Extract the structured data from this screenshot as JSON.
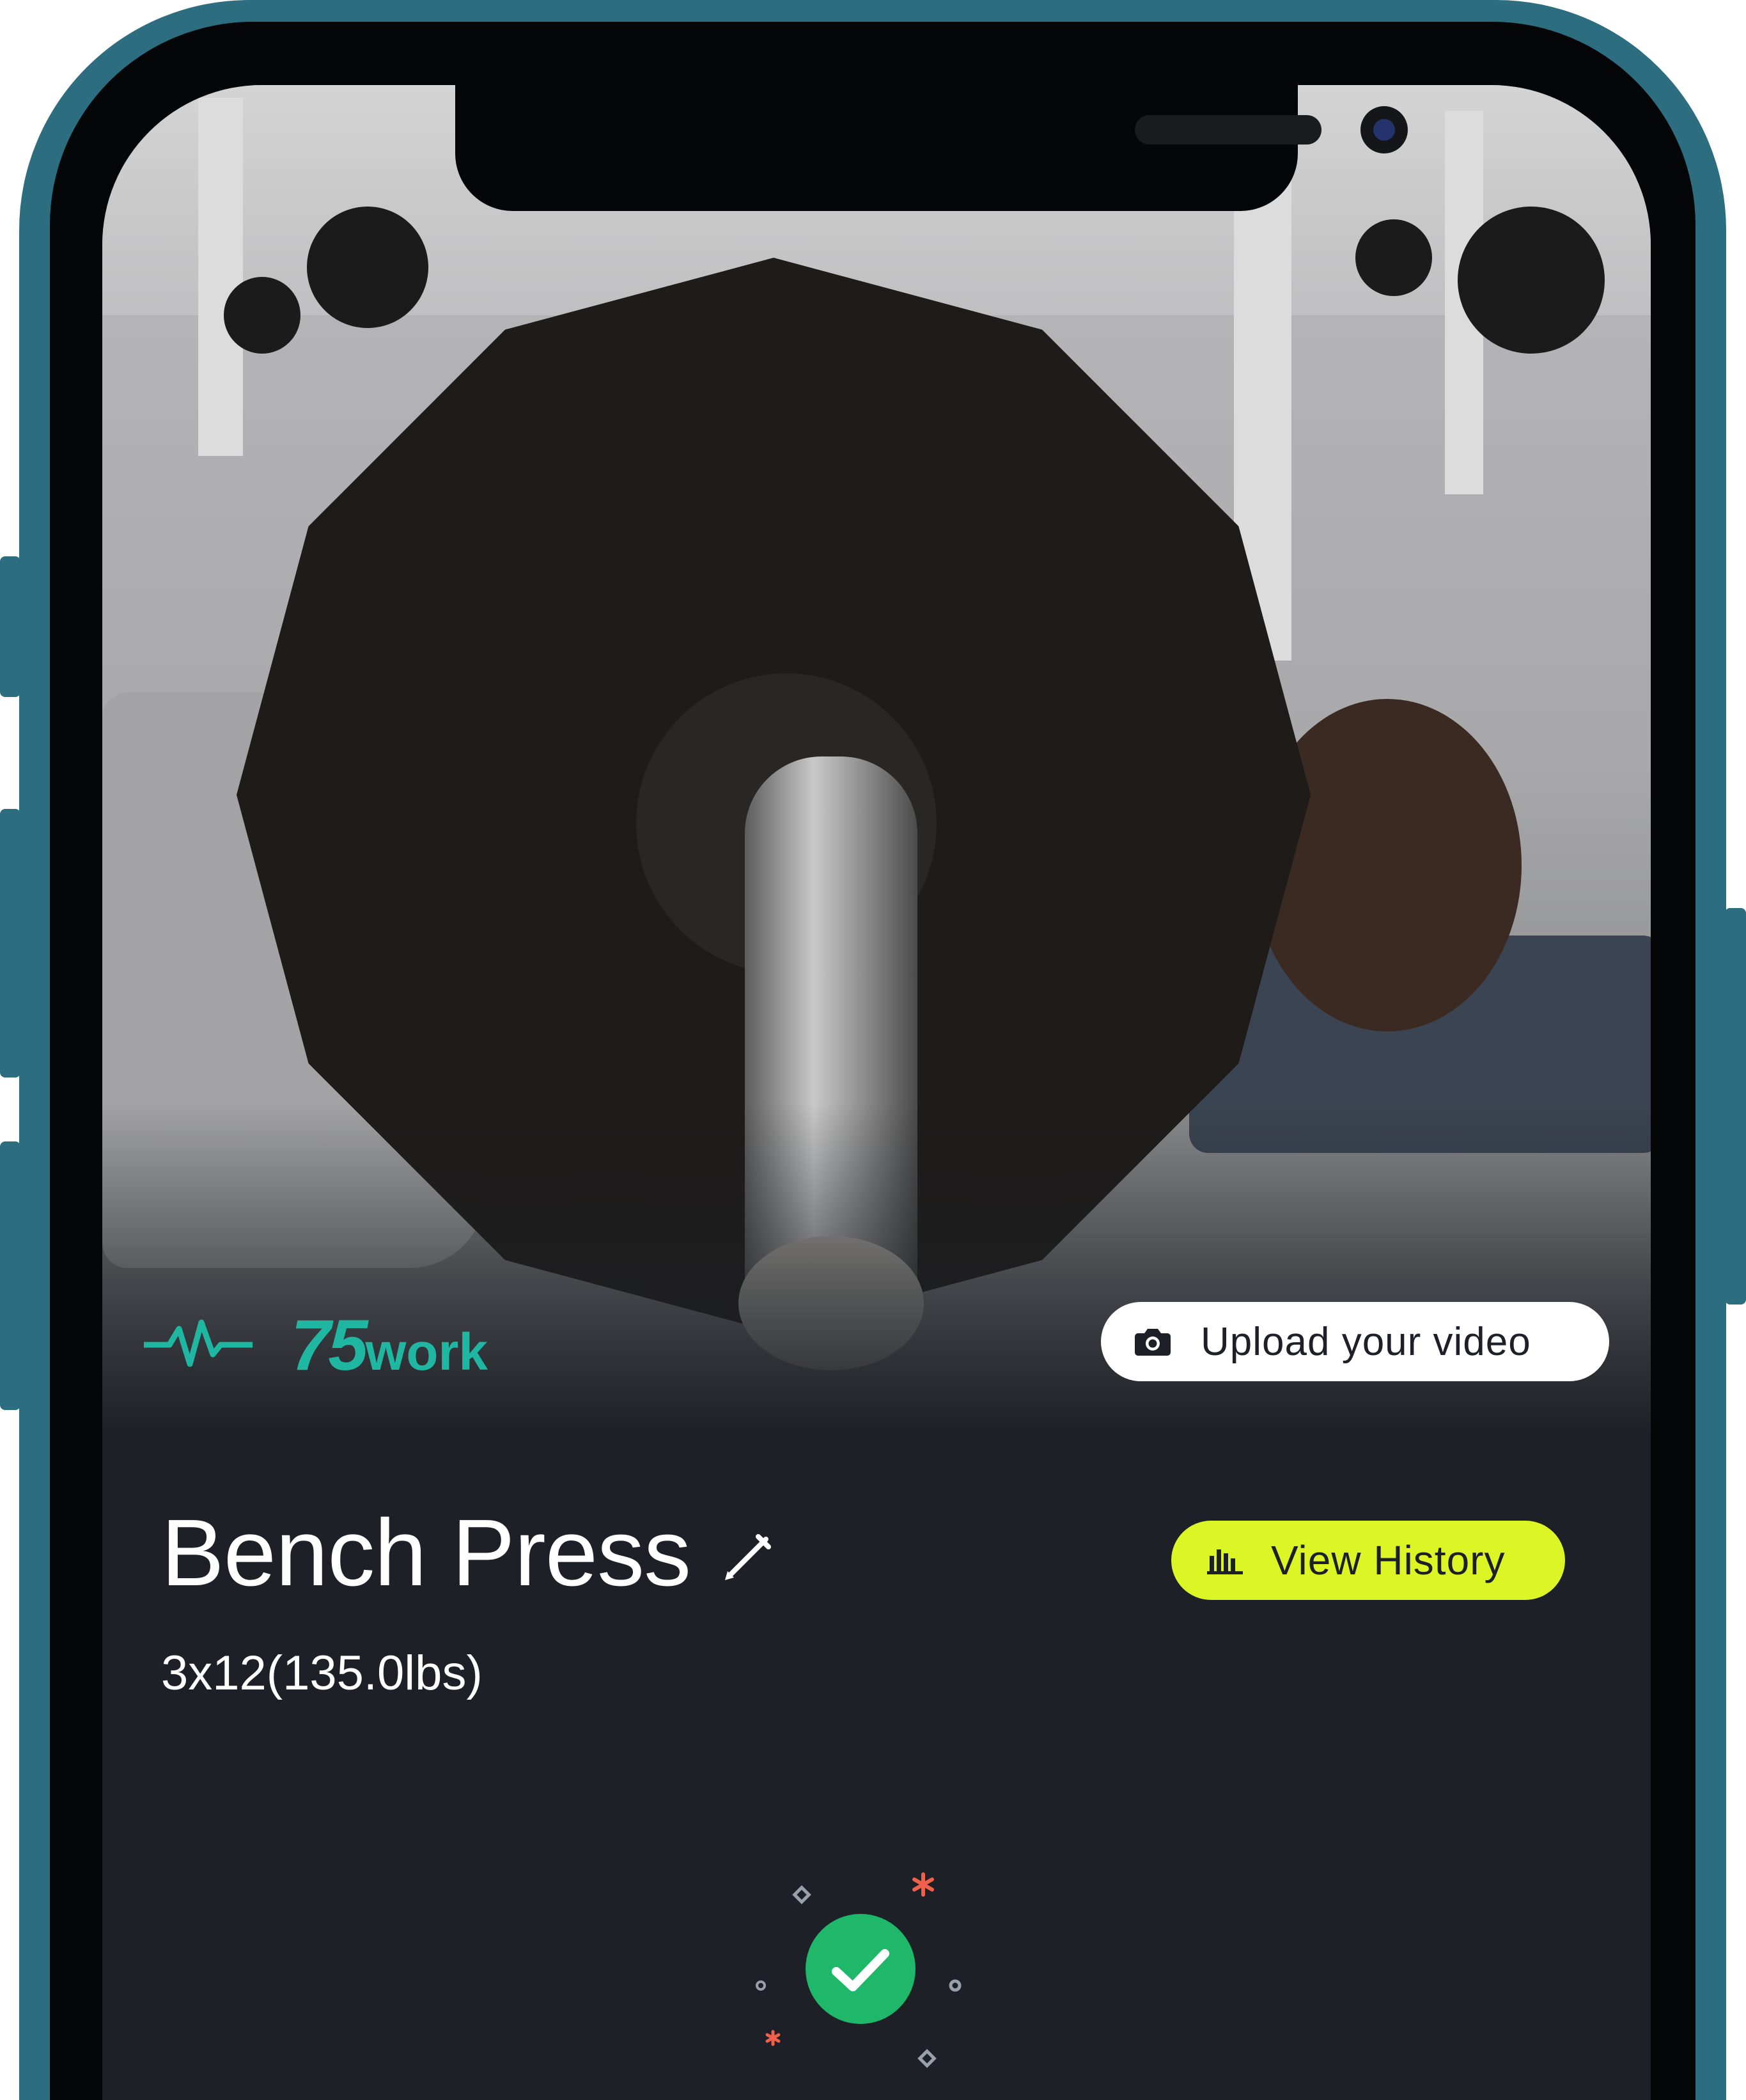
{
  "brand": {
    "number": "75",
    "word": "work"
  },
  "video": {
    "upload_label": "Upload your video"
  },
  "exercise": {
    "title": "Bench Press",
    "sets": "3x12(135.0lbs)"
  },
  "actions": {
    "history_label": "View History"
  },
  "colors": {
    "brand_teal": "#1fb6a2",
    "accent_lime": "#dcf524",
    "success_green": "#1fb86a",
    "background": "#1d2026",
    "phone_frame": "#2c6e80"
  },
  "icons": {
    "brand": "pulse-icon",
    "upload": "camera-icon",
    "edit": "pencil-icon",
    "history": "bar-chart-icon",
    "status": "checkmark-icon"
  }
}
